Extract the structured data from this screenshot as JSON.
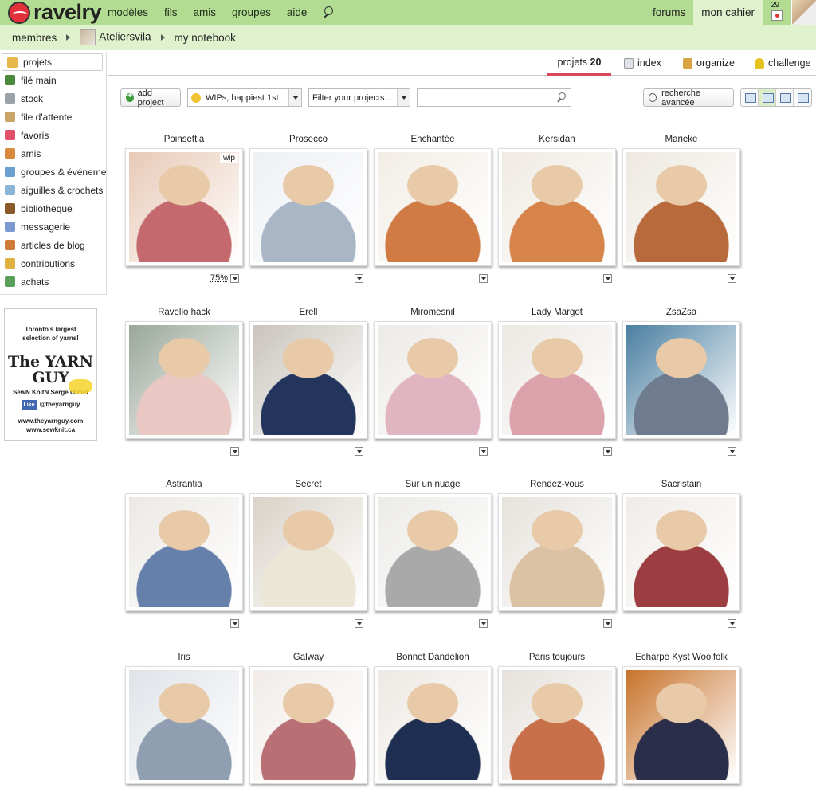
{
  "brand": {
    "name": "ravelry"
  },
  "nav": {
    "items": [
      "modèles",
      "fils",
      "amis",
      "groupes",
      "aide"
    ],
    "forums": "forums",
    "notebook": "mon cahier",
    "calendar_day": "29"
  },
  "breadcrumb": {
    "members": "membres",
    "user": "Ateliersvila",
    "page": "my notebook"
  },
  "sidebar": {
    "items": [
      {
        "label": "projets",
        "color": "#e6b84a"
      },
      {
        "label": "filé main",
        "color": "#4a8a3a"
      },
      {
        "label": "stock",
        "color": "#9aa3a8"
      },
      {
        "label": "file d'attente",
        "color": "#c9a56a"
      },
      {
        "label": "favoris",
        "color": "#e2506a"
      },
      {
        "label": "amis",
        "color": "#d88a3a"
      },
      {
        "label": "groupes & événements",
        "color": "#6aa0d0"
      },
      {
        "label": "aiguilles & crochets",
        "color": "#8ab4d8"
      },
      {
        "label": "bibliothèque",
        "color": "#8a5a2a"
      },
      {
        "label": "messagerie",
        "color": "#7a9ad0"
      },
      {
        "label": "articles de blog",
        "color": "#d07a3a"
      },
      {
        "label": "contributions",
        "color": "#e0b040"
      },
      {
        "label": "achats",
        "color": "#5aa05a"
      }
    ]
  },
  "ad": {
    "line1": "Toronto's largest",
    "line2": "selection of yarns!",
    "brand": "The YARN GUY",
    "tagline": "SewN KnitN Serge Outlet",
    "like": "Like",
    "handle": "@theyarnguy",
    "site1": "www.theyarnguy.com",
    "site2": "www.sewknit.ca"
  },
  "tabs": {
    "projects_label": "projets",
    "projects_count": "20",
    "index": "index",
    "organize": "organize",
    "challenge": "challenge"
  },
  "toolbar": {
    "add": "add project",
    "sort": "WIPs, happiest 1st",
    "filter": "Filter your projects...",
    "search_placeholder": "",
    "advanced": "recherche avancée"
  },
  "projects": [
    {
      "title": "Poinsettia",
      "badge": "wip",
      "progress": "75%",
      "c1": "#c46a6e",
      "c2": "#e8c9b6"
    },
    {
      "title": "Prosecco",
      "c1": "#a9b6c6",
      "c2": "#eef0f4"
    },
    {
      "title": "Enchantée",
      "c1": "#d07a44",
      "c2": "#f2ede6"
    },
    {
      "title": "Kersidan",
      "c1": "#d6844a",
      "c2": "#efeae2"
    },
    {
      "title": "Marieke",
      "c1": "#b86a3c",
      "c2": "#ede8e0"
    },
    {
      "title": "Ravello hack",
      "c1": "#e9c8c4",
      "c2": "#9aa79a"
    },
    {
      "title": "Erell",
      "c1": "#23355c",
      "c2": "#c9c4bc"
    },
    {
      "title": "Miromesnil",
      "c1": "#e1b4c2",
      "c2": "#eceae6"
    },
    {
      "title": "Lady Margot",
      "c1": "#dca2ab",
      "c2": "#ece8e3"
    },
    {
      "title": "ZsaZsa",
      "c1": "#6f7b8e",
      "c2": "#4a7fa0"
    },
    {
      "title": "Astrantia",
      "c1": "#6680ac",
      "c2": "#ece9e5"
    },
    {
      "title": "Secret",
      "c1": "#ece6d6",
      "c2": "#d9d2c8"
    },
    {
      "title": "Sur un nuage",
      "c1": "#a9a9a9",
      "c2": "#ecebe8"
    },
    {
      "title": "Rendez-vous",
      "c1": "#dcc2a4",
      "c2": "#e6e2dc"
    },
    {
      "title": "Sacristain",
      "c1": "#9c3d41",
      "c2": "#f0ece8"
    },
    {
      "title": "Iris",
      "c1": "#8f9eb0",
      "c2": "#dfe3e8"
    },
    {
      "title": "Galway",
      "c1": "#b87075",
      "c2": "#f1ece8"
    },
    {
      "title": "Bonnet Dandelion",
      "c1": "#1f2f52",
      "c2": "#ede9e4"
    },
    {
      "title": "Paris toujours",
      "c1": "#c7704a",
      "c2": "#e6e1dc"
    },
    {
      "title": "Echarpe Kyst Woolfolk",
      "c1": "#2a2e4a",
      "c2": "#c8742c"
    }
  ]
}
